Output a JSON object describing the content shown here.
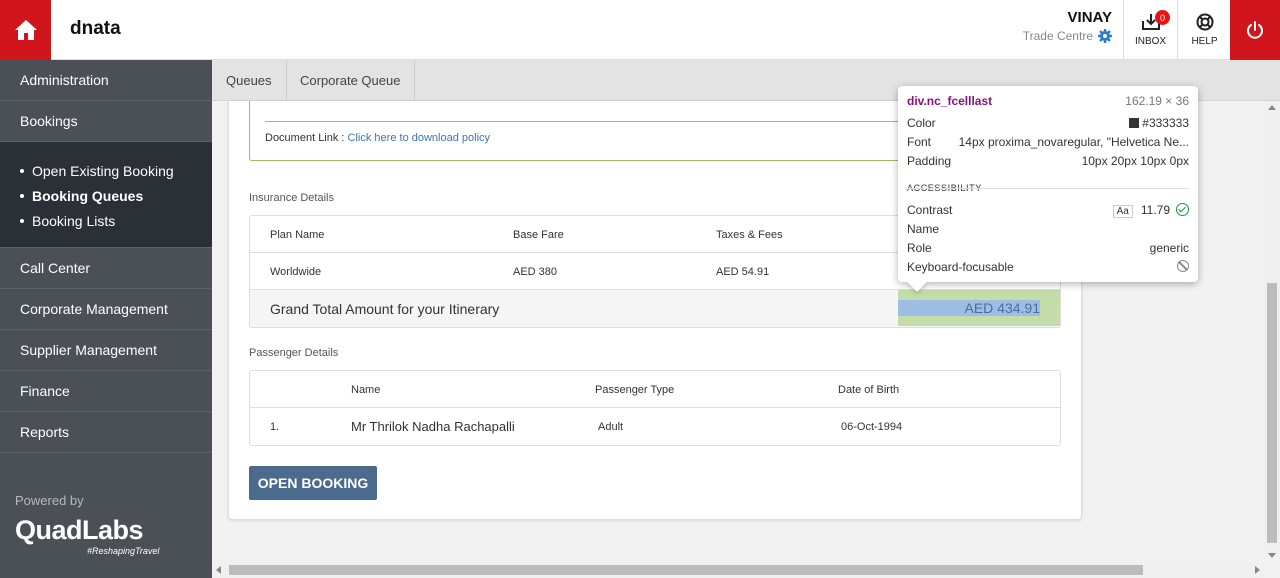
{
  "header": {
    "brand": "dnata",
    "user_name": "VINAY",
    "user_location": "Trade Centre",
    "inbox_label": "INBOX",
    "inbox_count": "0",
    "help_label": "HELP",
    "accent_color": "#d0161c"
  },
  "sidebar": {
    "items_top": [
      {
        "label": "Administration"
      },
      {
        "label": "Bookings"
      }
    ],
    "submenu": [
      {
        "label": "Open Existing Booking"
      },
      {
        "label": "Booking Queues"
      },
      {
        "label": "Booking Lists"
      }
    ],
    "items_bottom": [
      {
        "label": "Call Center"
      },
      {
        "label": "Corporate Management"
      },
      {
        "label": "Supplier Management"
      },
      {
        "label": "Finance"
      },
      {
        "label": "Reports"
      }
    ],
    "powered_by": "Powered by",
    "logo_text": "QuadLabs",
    "logo_tagline": "#ReshapingTravel"
  },
  "tabs": [
    {
      "label": "Queues"
    },
    {
      "label": "Corporate Queue"
    }
  ],
  "document": {
    "label": "Document Link : ",
    "link_text": "Click here to download policy"
  },
  "insurance": {
    "title": "Insurance Details",
    "headers": [
      "Plan Name",
      "Base Fare",
      "Taxes & Fees"
    ],
    "row": [
      "Worldwide",
      "AED 380",
      "AED 54.91"
    ],
    "total_label": "Grand Total Amount for your Itinerary",
    "total_value": "AED 434.91"
  },
  "passengers": {
    "title": "Passenger Details",
    "headers": [
      "Name",
      "Passenger Type",
      "Date of Birth"
    ],
    "rows": [
      {
        "index": "1.",
        "name": "Mr Thrilok Nadha Rachapalli",
        "type": "Adult",
        "dob": "06-Oct-1994"
      }
    ]
  },
  "open_booking_label": "OPEN BOOKING",
  "inspector": {
    "selector": "div.nc_fcelllast",
    "dimensions": "162.19 × 36",
    "color_label": "Color",
    "color_value": "#333333",
    "font_label": "Font",
    "font_value": "14px proxima_novaregular, \"Helvetica Ne...",
    "padding_label": "Padding",
    "padding_value": "10px 20px 10px 0px",
    "section": "ACCESSIBILITY",
    "contrast_label": "Contrast",
    "contrast_aa": "Aa",
    "contrast_value": "11.79",
    "name_label": "Name",
    "role_label": "Role",
    "role_value": "generic",
    "focus_label": "Keyboard-focusable"
  }
}
